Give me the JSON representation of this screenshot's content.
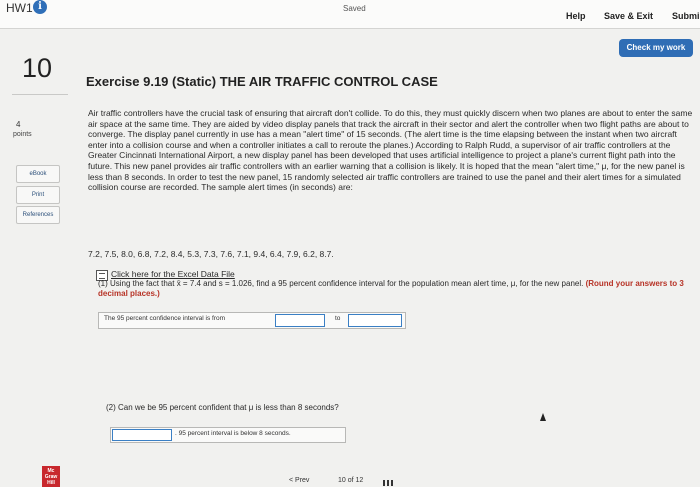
{
  "header": {
    "title": "HW1",
    "info_icon": "i",
    "status": "Saved",
    "help_label": "Help",
    "save_exit_label": "Save & Exit",
    "submit_label": "Submi"
  },
  "check_work_label": "Check my work",
  "question": {
    "number": "10",
    "points_value": "4",
    "points_label": "points"
  },
  "side_buttons": {
    "ebook": "eBook",
    "print": "Print",
    "references": "References"
  },
  "exercise": {
    "title": "Exercise 9.19 (Static) THE AIR TRAFFIC CONTROL CASE",
    "body": "Air traffic controllers have the crucial task of ensuring that aircraft don't collide. To do this, they must quickly discern when two planes are about to enter the same air space at the same time. They are aided by video display panels that track the aircraft in their sector and alert the controller when two flight paths are about to converge. The display panel currently in use has a mean \"alert time\" of 15 seconds. (The alert time is the time elapsing between the instant when two aircraft enter into a collision course and when a controller initiates a call to reroute the planes.) According to Ralph Rudd, a supervisor of air traffic controllers at the Greater Cincinnati International Airport, a new display panel has been developed that uses artificial intelligence to project a plane's current flight path into the future. This new panel provides air traffic controllers with an earlier warning that a collision is likely. It is hoped that the mean \"alert time,\" μ, for the new panel is less than 8 seconds. In order to test the new panel, 15 randomly selected air traffic controllers are trained to use the panel and their alert times for a simulated collision course are recorded. The sample alert times (in seconds) are:",
    "data_values": "7.2, 7.5, 8.0, 6.8, 7.2, 8.4, 5.3, 7.3, 7.6, 7.1, 9.4, 6.4, 7.9, 6.2, 8.7.",
    "file_link": "Click here for the Excel Data File"
  },
  "part1": {
    "prefix": "(1) Using the fact that x̄ = 7.4 and s = 1.026, find a 95 percent confidence interval for the population mean alert time, μ, for the new panel.",
    "emphasis": "(Round your answers to 3 decimal places.)",
    "answer_label": "The 95 percent confidence interval is from",
    "to_label": "to",
    "lower_value": "",
    "upper_value": ""
  },
  "part2": {
    "question": "(2) Can we be 95 percent confident that μ is less than 8 seconds?",
    "selected": "",
    "answer_label": ". 95 percent interval is below 8 seconds."
  },
  "footer": {
    "logo": "Mc Graw Hill",
    "prev_label": "< Prev",
    "page_indicator": "10 of 12"
  }
}
